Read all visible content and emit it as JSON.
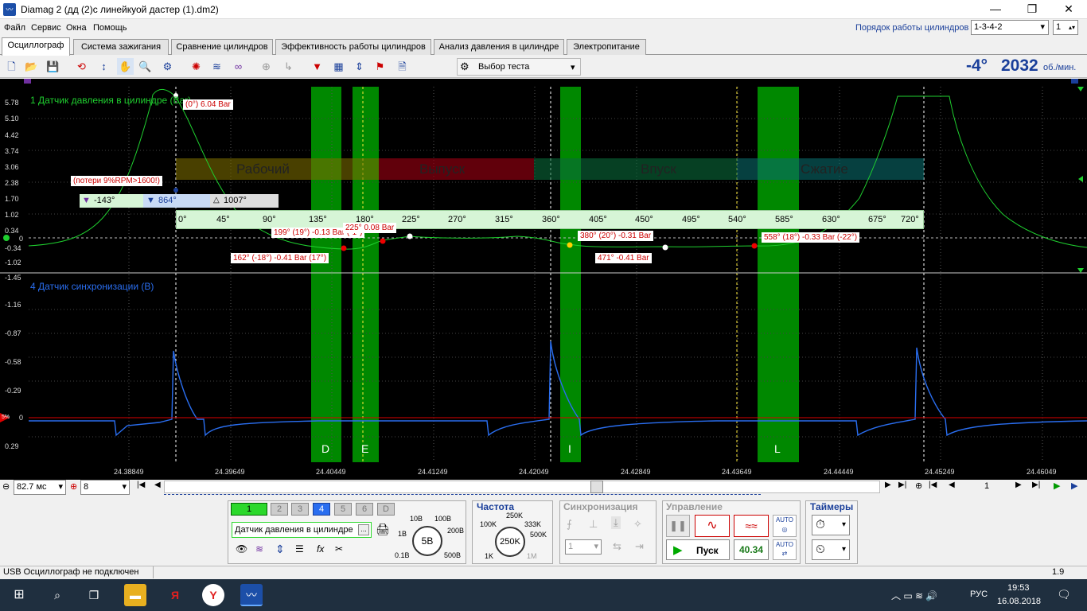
{
  "window": {
    "title": "Diamag 2 (дд (2)с линейкуой дастер (1).dm2)",
    "icon": "app-icon",
    "min": "—",
    "max": "❐",
    "close": "✕"
  },
  "menu": [
    "Файл",
    "Сервис",
    "Окна",
    "Помощь"
  ],
  "cylinder_order": {
    "label": "Порядок работы цилиндров",
    "value": "1-3-4-2",
    "count": "1"
  },
  "tabs": [
    "Осциллограф",
    "Система зажигания",
    "Сравнение цилиндров",
    "Эффективность работы цилиндров",
    "Анализ давления в цилиндре",
    "Электропитание"
  ],
  "toolbar": {
    "test_select": "Выбор теста",
    "angle": "-4°",
    "rpm": "2032",
    "rpm_unit": "об./мин."
  },
  "channel1": {
    "title": "1 Датчик давления в цилиндре (Bar)",
    "yticks": [
      "5.78",
      "5.10",
      "4.42",
      "3.74",
      "3.06",
      "2.38",
      "1.70",
      "1.02",
      "0.34",
      "0",
      "-0.34",
      "-1.02"
    ]
  },
  "channel4": {
    "title": "4 Датчик синхронизации (В)",
    "yticks": [
      "-1.45",
      "-1.16",
      "-0.87",
      "-0.58",
      "-0.29",
      "0",
      "0.29"
    ]
  },
  "strokes": [
    "Рабочий",
    "Выпуск",
    "Впуск",
    "Сжатие"
  ],
  "ruler_ticks": [
    "0°",
    "45°",
    "90°",
    "135°",
    "180°",
    "225°",
    "270°",
    "315°",
    "360°",
    "405°",
    "450°",
    "495°",
    "540°",
    "585°",
    "630°",
    "675°",
    "720°"
  ],
  "markers": {
    "m1": "-143°",
    "m2": "864°",
    "delta": "1007°",
    "loss": "(потери 9%RPM>1600!)"
  },
  "annotations": [
    {
      "text": "(0°) 6.04 Bar"
    },
    {
      "text": "199° (19°) -0.13 Bar (-1°)"
    },
    {
      "text": "225° 0.08 Bar"
    },
    {
      "text": "162° (-18°) -0.41 Bar (17°)"
    },
    {
      "text": "380° (20°) -0.31 Bar"
    },
    {
      "text": "471° -0.41 Bar"
    },
    {
      "text": "558° (18°) -0.33 Bar (-22°)"
    }
  ],
  "zones": [
    "D",
    "E",
    "I",
    "L"
  ],
  "xticks": [
    "24.38849",
    "24.39649",
    "24.40449",
    "24.41249",
    "24.42049",
    "24.42849",
    "24.43649",
    "24.44449",
    "24.45249",
    "24.46049"
  ],
  "nav": {
    "timebase": "82.7 мс",
    "count": "8",
    "page": "1"
  },
  "channels_buttons": [
    "1",
    "2",
    "3",
    "4",
    "5",
    "6",
    "D"
  ],
  "sensor_select": "Датчик давления в цилиндре",
  "volt": {
    "center": "5В",
    "labels": [
      "10В",
      "100В",
      "1В",
      "200В",
      "0.1В",
      "500В"
    ]
  },
  "freq": {
    "title": "Частота",
    "center": "250K",
    "labels": [
      "250K",
      "100K",
      "333K",
      "500K",
      "1K",
      "1M"
    ]
  },
  "sync": {
    "title": "Синхронизация",
    "value": "1"
  },
  "control": {
    "title": "Управление",
    "start": "Пуск",
    "value": "40.34",
    "auto": "AUTO"
  },
  "timers": {
    "title": "Таймеры"
  },
  "status": {
    "left": "USB Осциллограф не подключен",
    "right": "1.9"
  },
  "taskbar": {
    "time": "19:53",
    "date": "16.08.2018",
    "lang": "РУС"
  }
}
